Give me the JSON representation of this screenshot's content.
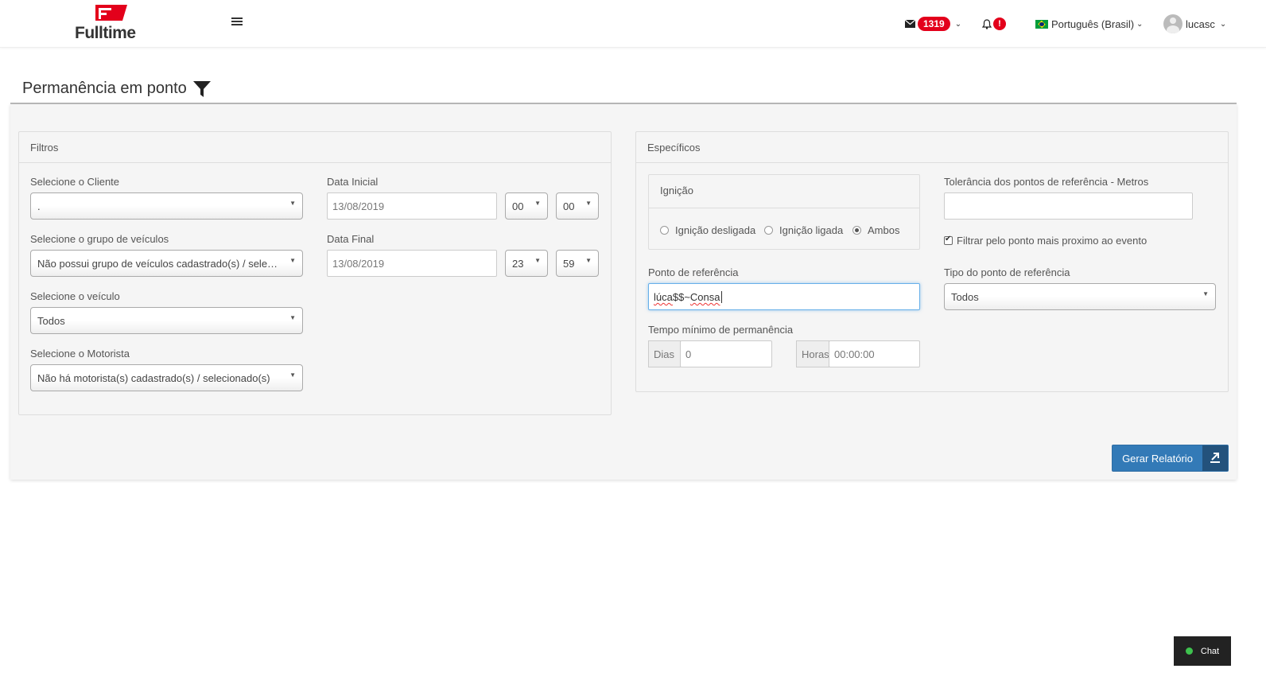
{
  "brand": {
    "name": "Fulltime",
    "color": "#e3001b"
  },
  "header": {
    "messages_count": "1319",
    "alert_badge": "!",
    "language": "Português (Brasil)",
    "username": "lucasc"
  },
  "page": {
    "title": "Permanência em ponto"
  },
  "filtros": {
    "title": "Filtros",
    "cliente": {
      "label": "Selecione o Cliente",
      "value": "."
    },
    "grupo": {
      "label": "Selecione o grupo de veículos",
      "value": "Não possui grupo de veículos cadastrado(s) / selecionado(s)"
    },
    "veiculo": {
      "label": "Selecione o veículo",
      "value": "Todos"
    },
    "motorista": {
      "label": "Selecione o Motorista",
      "value": "Não há motorista(s) cadastrado(s) / selecionado(s)"
    },
    "data_inicial": {
      "label": "Data Inicial",
      "date": "13/08/2019",
      "hour": "00",
      "minute": "00"
    },
    "data_final": {
      "label": "Data Final",
      "date": "13/08/2019",
      "hour": "23",
      "minute": "59"
    }
  },
  "especificos": {
    "title": "Específicos",
    "ignicao": {
      "title": "Ignição",
      "options": [
        "Ignição desligada",
        "Ignição ligada",
        "Ambos"
      ],
      "selected": "Ambos"
    },
    "tolerancia": {
      "label": "Tolerância dos pontos de referência - Metros",
      "value": ""
    },
    "filtrar_label": "Filtrar pelo ponto mais proximo ao evento",
    "ponto": {
      "label": "Ponto de referência",
      "value_part1": "lúca",
      "value_part2": "$$~",
      "value_part3": "Consa"
    },
    "tipo": {
      "label": "Tipo do ponto de referência",
      "value": "Todos"
    },
    "tempo": {
      "label": "Tempo mínimo de permanência",
      "dias_label": "Dias",
      "dias_value": "0",
      "horas_label": "Horas",
      "horas_value": "00:00:00"
    }
  },
  "actions": {
    "report_button": "Gerar Relatório"
  },
  "chat": {
    "label": "Chat"
  }
}
